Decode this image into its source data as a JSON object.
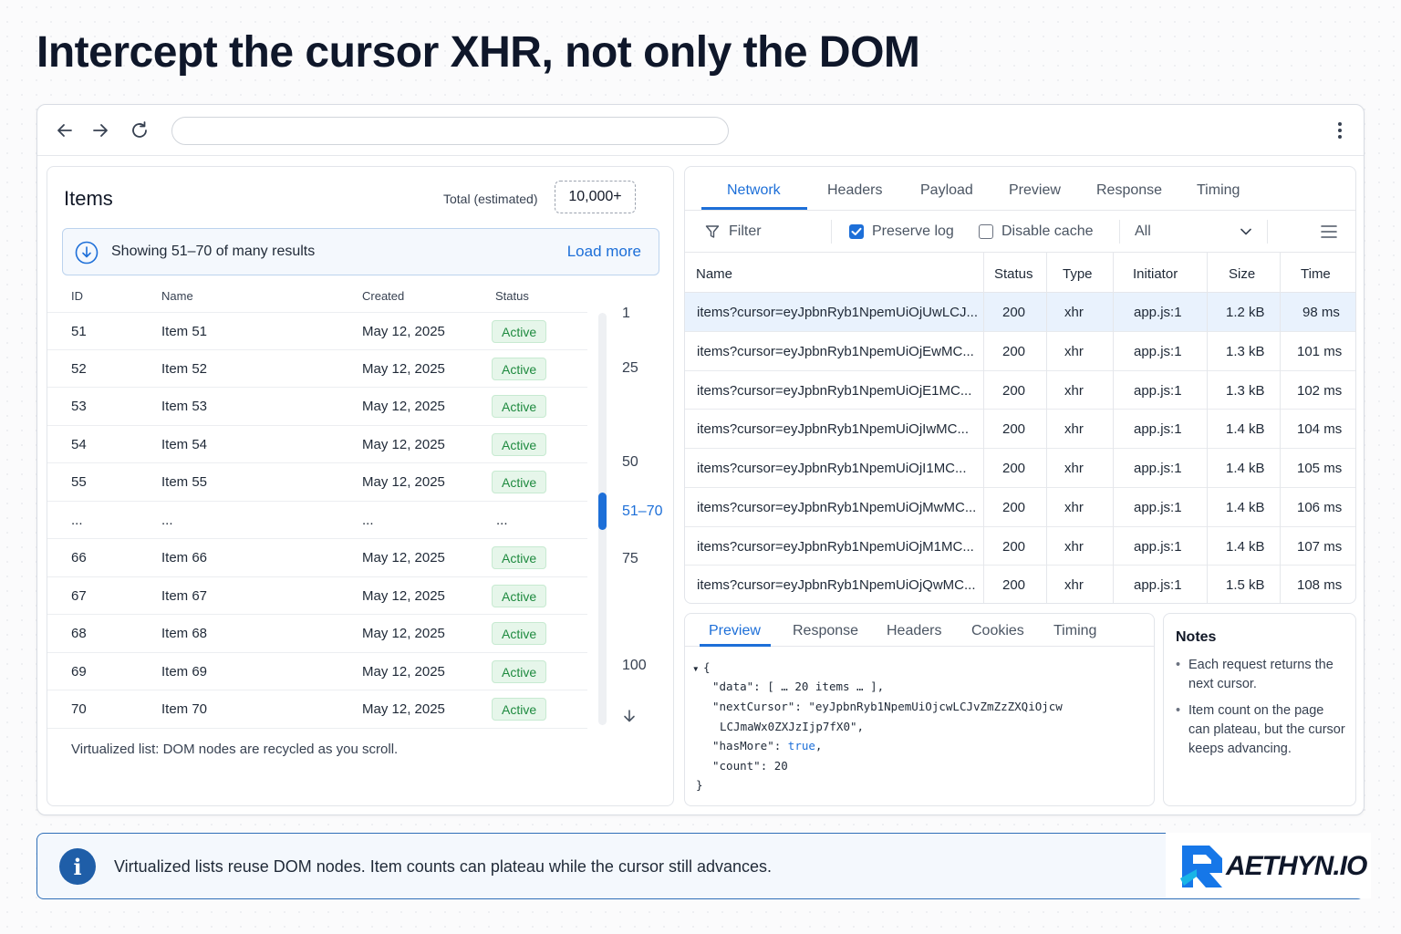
{
  "headline": "Intercept the cursor XHR, not only the DOM",
  "browser": {
    "address_value": "",
    "icons": [
      "back-arrow-icon",
      "forward-arrow-icon",
      "reload-icon",
      "more-vertical-icon"
    ]
  },
  "items_panel": {
    "title": "Items",
    "total_label": "Total (estimated)",
    "total_value": "10,000+",
    "banner_text": "Showing 51–70 of many results",
    "load_more": "Load more",
    "columns": [
      "ID",
      "Name",
      "Created",
      "Status"
    ],
    "rows": [
      {
        "id": "51",
        "name": "Item 51",
        "created": "May 12, 2025",
        "status": "Active"
      },
      {
        "id": "52",
        "name": "Item 52",
        "created": "May 12, 2025",
        "status": "Active"
      },
      {
        "id": "53",
        "name": "Item 53",
        "created": "May 12, 2025",
        "status": "Active"
      },
      {
        "id": "54",
        "name": "Item 54",
        "created": "May 12, 2025",
        "status": "Active"
      },
      {
        "id": "55",
        "name": "Item 55",
        "created": "May 12, 2025",
        "status": "Active"
      },
      {
        "id": "...",
        "name": "...",
        "created": "...",
        "status": "..."
      },
      {
        "id": "66",
        "name": "Item 66",
        "created": "May 12, 2025",
        "status": "Active"
      },
      {
        "id": "67",
        "name": "Item 67",
        "created": "May 12, 2025",
        "status": "Active"
      },
      {
        "id": "68",
        "name": "Item 68",
        "created": "May 12, 2025",
        "status": "Active"
      },
      {
        "id": "69",
        "name": "Item 69",
        "created": "May 12, 2025",
        "status": "Active"
      },
      {
        "id": "70",
        "name": "Item 70",
        "created": "May 12, 2025",
        "status": "Active"
      }
    ],
    "page_markers": [
      "1",
      "25",
      "50",
      "51–70",
      "75",
      "100"
    ],
    "active_marker": "51–70",
    "footer": "Virtualized list: DOM nodes are recycled as you scroll."
  },
  "network": {
    "tabs": [
      "Network",
      "Headers",
      "Payload",
      "Preview",
      "Response",
      "Timing"
    ],
    "active_tab": "Network",
    "filter": "Filter",
    "preserve_log": "Preserve log",
    "preserve_log_checked": true,
    "disable_cache": "Disable cache",
    "disable_cache_checked": false,
    "type_select": "All",
    "columns": [
      "Name",
      "Status",
      "Type",
      "Initiator",
      "Size",
      "Time"
    ],
    "rows": [
      {
        "name": "items?cursor=eyJpbnRyb1NpemUiOjUwLCJ...",
        "status": "200",
        "type": "xhr",
        "initiator": "app.js:1",
        "size": "1.2 kB",
        "time": "98 ms"
      },
      {
        "name": "items?cursor=eyJpbnRyb1NpemUiOjEwMC...",
        "status": "200",
        "type": "xhr",
        "initiator": "app.js:1",
        "size": "1.3 kB",
        "time": "101 ms"
      },
      {
        "name": "items?cursor=eyJpbnRyb1NpemUiOjE1MC...",
        "status": "200",
        "type": "xhr",
        "initiator": "app.js:1",
        "size": "1.3 kB",
        "time": "102 ms"
      },
      {
        "name": "items?cursor=eyJpbnRyb1NpemUiOjIwMC...",
        "status": "200",
        "type": "xhr",
        "initiator": "app.js:1",
        "size": "1.4 kB",
        "time": "104 ms"
      },
      {
        "name": "items?cursor=eyJpbnRyb1NpemUiOjI1MC...",
        "status": "200",
        "type": "xhr",
        "initiator": "app.js:1",
        "size": "1.4 kB",
        "time": "105 ms"
      },
      {
        "name": "items?cursor=eyJpbnRyb1NpemUiOjMwMC...",
        "status": "200",
        "type": "xhr",
        "initiator": "app.js:1",
        "size": "1.4 kB",
        "time": "106 ms"
      },
      {
        "name": "items?cursor=eyJpbnRyb1NpemUiOjM1MC...",
        "status": "200",
        "type": "xhr",
        "initiator": "app.js:1",
        "size": "1.4 kB",
        "time": "107 ms"
      },
      {
        "name": "items?cursor=eyJpbnRyb1NpemUiOjQwMC...",
        "status": "200",
        "type": "xhr",
        "initiator": "app.js:1",
        "size": "1.5 kB",
        "time": "108 ms"
      }
    ],
    "selected_row": 0
  },
  "preview": {
    "tabs": [
      "Preview",
      "Response",
      "Headers",
      "Cookies",
      "Timing"
    ],
    "active_tab": "Preview",
    "code": {
      "open": "{",
      "data_key": "\"data\"",
      "data_value": "[ … 20 items … ],",
      "next_key": "\"nextCursor\"",
      "next_value_1": "\"eyJpbnRyb1NpemUiOjcwLCJvZmZzZXQiOjcw",
      "next_value_2": "LCJmaWx0ZXJzIjp7fX0\",",
      "hasmore_key": "\"hasMore\"",
      "hasmore_value": "true",
      "count_key": "\"count\"",
      "count_value": "20",
      "close": "}"
    }
  },
  "notes": {
    "title": "Notes",
    "items": [
      "Each request returns the next cursor.",
      "Item count on the page can plateau, but the cursor keeps advancing."
    ]
  },
  "info_bar": {
    "icon": "info-icon",
    "text": "Virtualized lists reuse DOM nodes. Item counts can plateau while the cursor still advances."
  },
  "logo": {
    "text": "AETHYN.IO"
  },
  "colors": {
    "accent": "#1d6fd8",
    "active_badge_bg": "#e6f6ea",
    "active_badge_text": "#1e8a3f",
    "info_bar_border": "#2f6fb8"
  }
}
